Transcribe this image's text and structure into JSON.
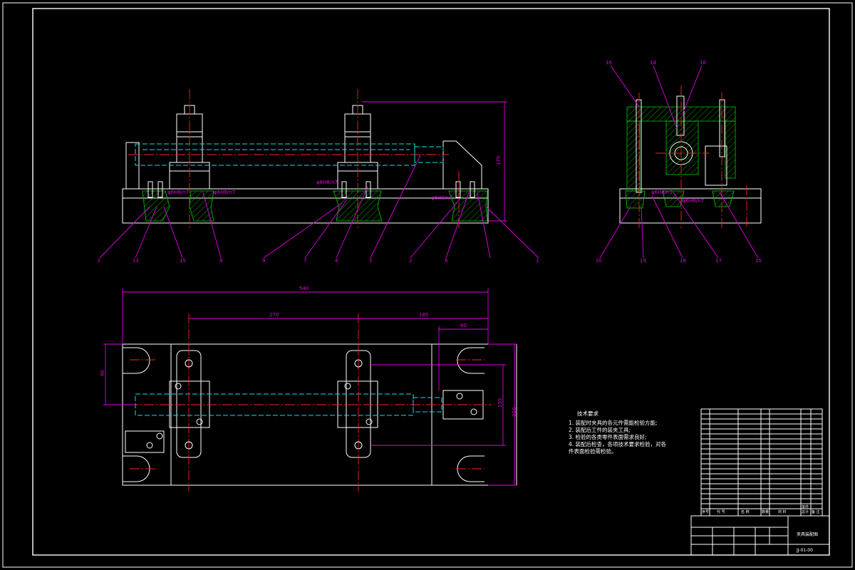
{
  "front_view": {
    "dim_height": "175",
    "fit_labels": [
      "φ6H8/n7",
      "φ6H8/n7",
      "φ6H8/n7",
      "φ6H8/n7"
    ],
    "balloons": [
      "3",
      "11",
      "15",
      "8",
      "9",
      "7",
      "4",
      "5",
      "2",
      "6",
      "1"
    ]
  },
  "side_view": {
    "fit_labels": [
      "φ6H8/n7",
      "φ6H8/n7"
    ],
    "balloons_top": [
      "16",
      "14",
      "16"
    ],
    "balloons_bottom": [
      "20",
      "19",
      "18",
      "17",
      "15"
    ]
  },
  "top_view": {
    "dim_overall": "540",
    "dim_2": "270",
    "dim_3": "185",
    "dim_4": "80",
    "dim_left": "90",
    "dim_r1": "155",
    "dim_r2": "210"
  },
  "tech_notes": {
    "title": "技术要求",
    "lines": [
      "1. 装配时夹具的各元件需能检验方能;",
      "2. 装配后工件的装夹工具;",
      "3. 检验的各类零件表面需求良好;",
      "4. 装配后检查，各项技术要求检验，对各",
      "件表面检验需检验。"
    ]
  },
  "title_block": {
    "drawing_title": "夹具装配图",
    "drawing_no": "JJ-01-00",
    "headers": [
      "序号",
      "代 号",
      "名 称",
      "数量",
      "材 料",
      "单件",
      "总计",
      "备 注"
    ]
  }
}
